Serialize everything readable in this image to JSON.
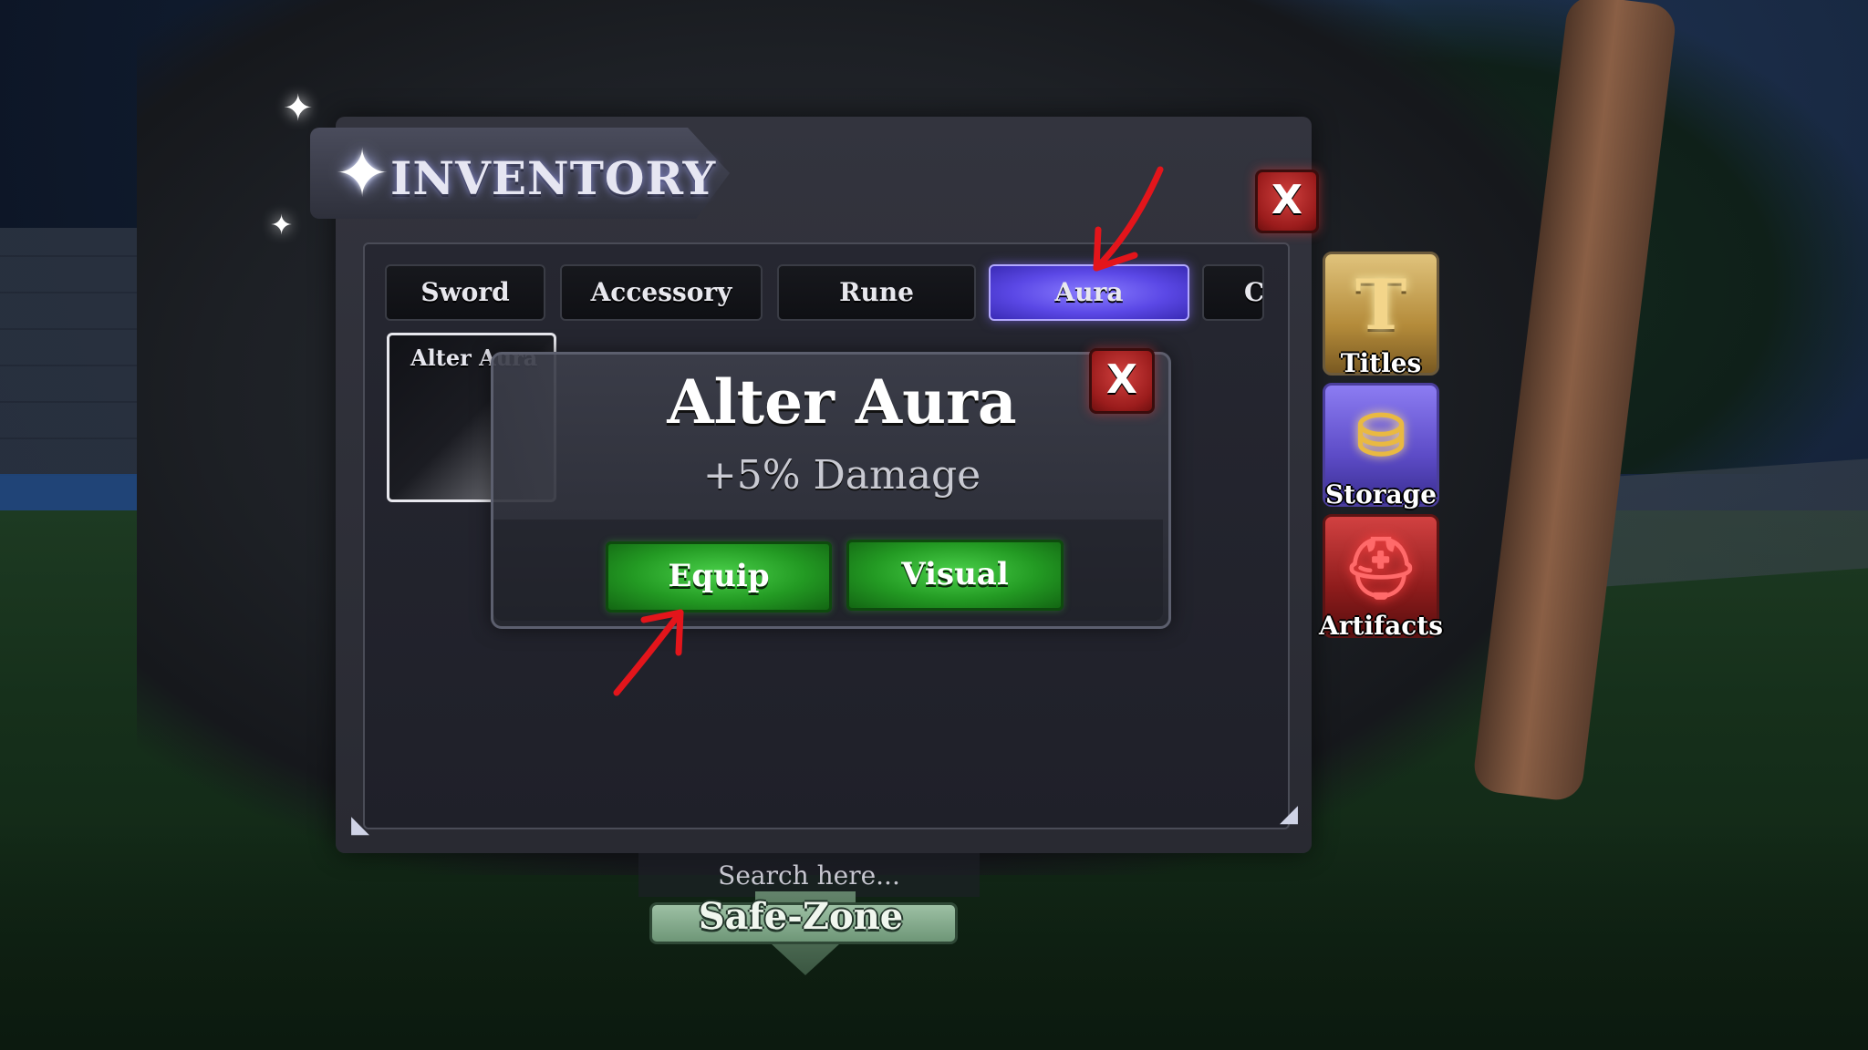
{
  "window": {
    "title": "INVENTORY",
    "close_label": "X"
  },
  "tabs": [
    {
      "label": "Sword",
      "active": false
    },
    {
      "label": "Accessory",
      "active": false
    },
    {
      "label": "Rune",
      "active": false
    },
    {
      "label": "Aura",
      "active": true
    },
    {
      "label": "C",
      "active": false
    }
  ],
  "items": [
    {
      "name": "Alter Aura"
    }
  ],
  "detail": {
    "name": "Alter Aura",
    "stat": "+5% Damage",
    "close_label": "X",
    "equip_label": "Equip",
    "visual_label": "Visual"
  },
  "side_menu": [
    {
      "label": "Titles",
      "icon": "title-t-icon"
    },
    {
      "label": "Storage",
      "icon": "storage-jar-icon"
    },
    {
      "label": "Artifacts",
      "icon": "helmet-icon"
    }
  ],
  "search": {
    "placeholder": "Search here..."
  },
  "zone": {
    "label": "Safe-Zone"
  },
  "colors": {
    "active_tab": "#5b48e6",
    "close_red": "#9b1c1c",
    "button_green": "#239a23",
    "annotation_red": "#e3151b"
  }
}
